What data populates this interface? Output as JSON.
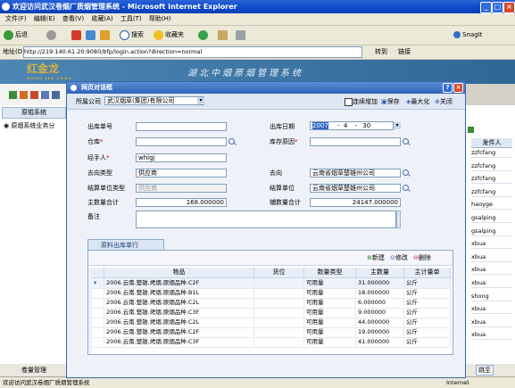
{
  "browser": {
    "title": "欢迎访问武汉卷烟厂质烟管理系统 - Microsoft Internet Explorer",
    "menu": [
      "文件(F)",
      "编辑(E)",
      "查看(V)",
      "收藏(A)",
      "工具(T)",
      "帮助(H)"
    ],
    "toolbar": {
      "back": "后退",
      "search": "搜索",
      "favorites": "收藏夹",
      "snagit": "SnagIt"
    },
    "address_label": "地址(D)",
    "address": "http://219.140.61.20:9080/bfp/login.action?direction=normal",
    "go_label": "转到",
    "links_label": "链接",
    "status_url": "http://219.140.61.20:9080/bfp/mainFrame.action?url=TobProMovOutMnt.action?operation=create&2&ac",
    "zone": "Internet"
  },
  "app": {
    "logo": "红金龙",
    "logo_sub": "HONG JIN LONG",
    "slogan": "湖北中烟原烟管理系统",
    "left_tab": "原辊系统",
    "left_item": "原烟系统业务分",
    "bottom_left": "卷量管理",
    "taskbar": "欢迎访问武汉卷烟厂质烟管理系统",
    "page_btn": "跳至",
    "right_header": "发件人",
    "right_rows": [
      "zzfcfang",
      "zzfcfang",
      "zzfcfang",
      "zzfcfang",
      "haoyge",
      "gsalping",
      "gsalping",
      "xbua",
      "xbua",
      "xbua",
      "xbua",
      "shong",
      "xbua",
      "xbua",
      "xbua"
    ]
  },
  "dialog": {
    "title": "网页对话框",
    "company_label": "所属公司",
    "company_value": "武汉烟草(集团)有限公司",
    "cont_add": "连续增加",
    "save": "保存",
    "maximize": "最大化",
    "close": "关闭",
    "form": {
      "out_no_label": "出库单号",
      "out_no": "",
      "out_date_label": "出库日期",
      "out_date_y": "2007",
      "out_date_m": "4",
      "out_date_d": "30",
      "warehouse_label": "仓库",
      "warehouse": "",
      "reason_label": "库存原因",
      "reason": "",
      "handler_label": "经手人",
      "handler": "whlgj",
      "dest_type_label": "去向类型",
      "dest_type": "供应商",
      "dest_label": "去向",
      "dest": "云南省烟草楚雄州公司",
      "settle_type_label": "结算单位类型",
      "settle_type": "供应商",
      "settle_unit_label": "结算单位",
      "settle_unit": "云南省烟草楚雄州公司",
      "main_qty_label": "主数量合计",
      "main_qty": "168.000000",
      "aux_qty_label": "辅数量合计",
      "aux_qty": "24147.000000",
      "remark_label": "备注",
      "remark": ""
    },
    "grid": {
      "tab": "原料出库单行",
      "new": "新建",
      "edit": "修改",
      "delete": "删除",
      "headers": [
        "物品",
        "货位",
        "数量类型",
        "主数量",
        "主计量单"
      ],
      "rows": [
        [
          "2006.云南.楚雄.烤烟.原烟品种.C2F",
          "",
          "可用量",
          "31.000000",
          "公斤"
        ],
        [
          "2006.云南.楚雄.烤烟.原烟品种.B1L",
          "",
          "可用量",
          "18.000000",
          "公斤"
        ],
        [
          "2006.云南.楚雄.烤烟.原烟品种.C2L",
          "",
          "可用量",
          "6.000000",
          "公斤"
        ],
        [
          "2006.云南.楚雄.烤烟.原烟品种.C3F",
          "",
          "可用量",
          "9.000000",
          "公斤"
        ],
        [
          "2006.云南.楚雄.烤烟.原烟品种.C2L",
          "",
          "可用量",
          "44.000000",
          "公斤"
        ],
        [
          "2006.云南.楚雄.烤烟.原烟品种.C2F",
          "",
          "可用量",
          "19.000000",
          "公斤"
        ],
        [
          "2006.云南.楚雄.烤烟.原烟品种.C3F",
          "",
          "可用量",
          "41.000000",
          "公斤"
        ]
      ]
    }
  }
}
